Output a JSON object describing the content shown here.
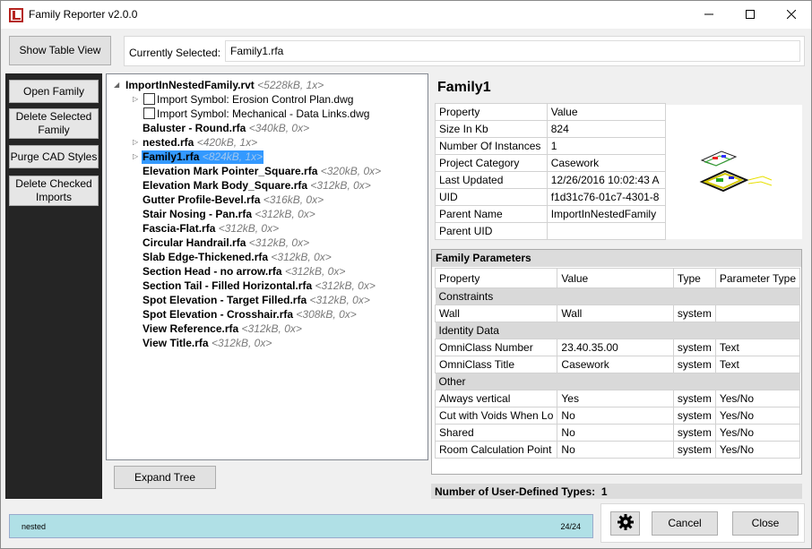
{
  "window": {
    "title": "Family Reporter v2.0.0"
  },
  "toolbar": {
    "show_table_view": "Show Table View",
    "currently_selected_label": "Currently Selected:",
    "currently_selected_value": "Family1.rfa"
  },
  "sidebar": {
    "buttons": [
      "Open Family",
      "Delete Selected Family",
      "Purge CAD Styles",
      "Delete Checked Imports"
    ]
  },
  "tree": {
    "root": {
      "name": "ImportInNestedFamily.rvt",
      "meta": "<5228kB, 1x>"
    },
    "imports": [
      "Import Symbol: Erosion Control Plan.dwg",
      "Import Symbol: Mechanical - Data Links.dwg"
    ],
    "items": [
      {
        "name": "Baluster - Round.rfa",
        "meta": "<340kB, 0x>"
      },
      {
        "name": "nested.rfa",
        "meta": "<420kB, 1x>"
      },
      {
        "name": "Family1.rfa",
        "meta": "<824kB, 1x>"
      },
      {
        "name": "Elevation Mark Pointer_Square.rfa",
        "meta": "<320kB, 0x>"
      },
      {
        "name": "Elevation Mark Body_Square.rfa",
        "meta": "<312kB, 0x>"
      },
      {
        "name": "Gutter Profile-Bevel.rfa",
        "meta": "<316kB, 0x>"
      },
      {
        "name": "Stair Nosing - Pan.rfa",
        "meta": "<312kB, 0x>"
      },
      {
        "name": "Fascia-Flat.rfa",
        "meta": "<312kB, 0x>"
      },
      {
        "name": "Circular Handrail.rfa",
        "meta": "<312kB, 0x>"
      },
      {
        "name": "Slab Edge-Thickened.rfa",
        "meta": "<312kB, 0x>"
      },
      {
        "name": "Section Head - no arrow.rfa",
        "meta": "<312kB, 0x>"
      },
      {
        "name": "Section Tail - Filled Horizontal.rfa",
        "meta": "<312kB, 0x>"
      },
      {
        "name": "Spot Elevation - Target Filled.rfa",
        "meta": "<312kB, 0x>"
      },
      {
        "name": "Spot Elevation - Crosshair.rfa",
        "meta": "<308kB, 0x>"
      },
      {
        "name": "View Reference.rfa",
        "meta": "<312kB, 0x>"
      },
      {
        "name": "View Title.rfa",
        "meta": "<312kB, 0x>"
      }
    ],
    "expand_label": "Expand Tree"
  },
  "details": {
    "title": "Family1",
    "props_header": [
      "Property",
      "Value"
    ],
    "props": [
      [
        "Size In Kb",
        "824"
      ],
      [
        "Number Of Instances",
        "1"
      ],
      [
        "Project Category",
        "Casework"
      ],
      [
        "Last Updated",
        "12/26/2016 10:02:43 A"
      ],
      [
        "UID",
        "f1d31c76-01c7-4301-8"
      ],
      [
        "Parent Name",
        "ImportInNestedFamily"
      ],
      [
        "Parent UID",
        ""
      ]
    ]
  },
  "family_params": {
    "title": "Family Parameters",
    "header": [
      "Property",
      "Value",
      "Type",
      "Parameter Type"
    ],
    "groups": [
      {
        "name": "Constraints",
        "rows": [
          [
            "Wall",
            "Wall",
            "system",
            ""
          ]
        ]
      },
      {
        "name": "Identity Data",
        "rows": [
          [
            "OmniClass Number",
            "23.40.35.00",
            "system",
            "Text"
          ],
          [
            "OmniClass Title",
            "Casework",
            "system",
            "Text"
          ]
        ]
      },
      {
        "name": "Other",
        "rows": [
          [
            "Always vertical",
            "Yes",
            "system",
            "Yes/No"
          ],
          [
            "Cut with Voids When Lo",
            "No",
            "system",
            "Yes/No"
          ],
          [
            "Shared",
            "No",
            "system",
            "Yes/No"
          ],
          [
            "Room Calculation Point",
            "No",
            "system",
            "Yes/No"
          ]
        ]
      }
    ],
    "user_types_label": "Number of User-Defined Types:",
    "user_types_count": "1"
  },
  "status": {
    "text": "nested",
    "count": "24/24"
  },
  "footer": {
    "cancel": "Cancel",
    "close": "Close"
  }
}
